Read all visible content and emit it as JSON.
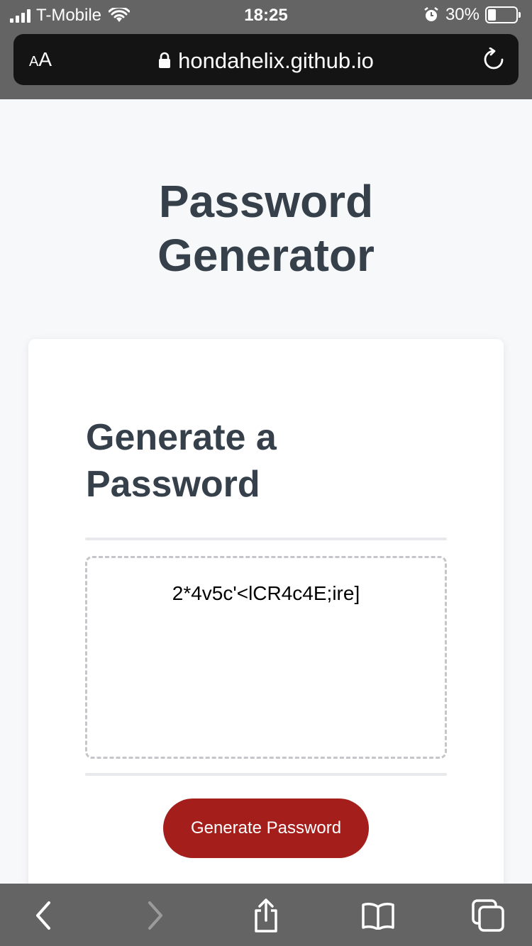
{
  "status_bar": {
    "carrier": "T-Mobile",
    "time": "18:25",
    "battery_percent": "30%",
    "battery_level": 0.3
  },
  "browser": {
    "text_size_label_small": "A",
    "text_size_label_large": "A",
    "url": "hondahelix.github.io"
  },
  "page": {
    "title": "Password Generator",
    "card_title": "Generate a Password",
    "password": "2*4v5c'<lCR4c4E;ire]",
    "generate_button_label": "Generate Password",
    "button_color": "#a41f1c",
    "heading_color": "#36404b"
  },
  "toolbar": {
    "icons": [
      "back-icon",
      "forward-icon",
      "share-icon",
      "bookmarks-icon",
      "tabs-icon"
    ]
  }
}
